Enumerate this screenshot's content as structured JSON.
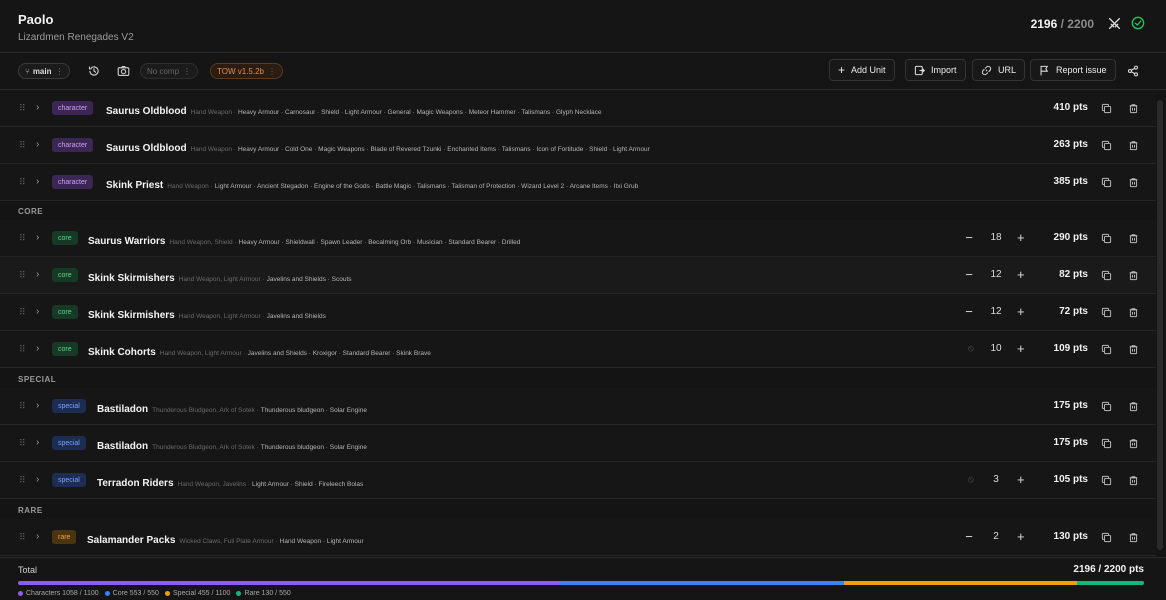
{
  "header": {
    "title": "Paolo",
    "subtitle": "Lizardmen Renegades V2",
    "points_current": "2196",
    "points_max": "2200"
  },
  "toolbar": {
    "branch": "main",
    "comp": "No comp",
    "version": "TOW v1.5.2b",
    "add_unit": "Add Unit",
    "import": "Import",
    "url": "URL",
    "report": "Report issue"
  },
  "sections": {
    "core": "CORE",
    "special": "SPECIAL",
    "rare": "RARE"
  },
  "units": [
    {
      "category": "character",
      "name": "Saurus Oldblood",
      "defaults": "Hand Weapon ·",
      "options": "Heavy Armour · Carnosaur · Shield · Light Armour · General · Magic Weapons · Meteor Hammer · Talismans · Glyph Necklace",
      "qty": "",
      "points": "410 pts"
    },
    {
      "category": "character",
      "name": "Saurus Oldblood",
      "defaults": "Hand Weapon ·",
      "options": "Heavy Armour · Cold One · Magic Weapons · Blade of Revered Tzunki · Enchanted Items · Talismans · Icon of Fortitude · Shield · Light Armour",
      "qty": "",
      "points": "263 pts"
    },
    {
      "category": "character",
      "name": "Skink Priest",
      "defaults": "Hand Weapon ·",
      "options": "Light Armour · Ancient Stegadon · Engine of the Gods · Battle Magic · Talismans · Talisman of Protection · Wizard Level 2 · Arcane Items · Itxi Grub",
      "qty": "",
      "points": "385 pts"
    },
    {
      "category": "core",
      "name": "Saurus Warriors",
      "defaults": "Hand Weapon, Shield ·",
      "options": "Heavy Armour · Shieldwall · Spawn Leader · Becalming Orb · Musician · Standard Bearer · Drilled",
      "qty": "18",
      "points": "290 pts"
    },
    {
      "category": "core",
      "name": "Skink Skirmishers",
      "defaults": "Hand Weapon, Light Armour ·",
      "options": "Javelins and Shields · Scouts",
      "qty": "12",
      "points": "82 pts"
    },
    {
      "category": "core",
      "name": "Skink Skirmishers",
      "defaults": "Hand Weapon, Light Armour ·",
      "options": "Javelins and Shields",
      "qty": "12",
      "points": "72 pts"
    },
    {
      "category": "core",
      "name": "Skink Cohorts",
      "defaults": "Hand Weapon, Light Armour ·",
      "options": "Javelins and Shields · Kroxigor · Standard Bearer · Skink Brave",
      "qty": "10",
      "points": "109 pts"
    },
    {
      "category": "special",
      "name": "Bastiladon",
      "defaults": "Thunderous Bludgeon, Ark of Sotek ·",
      "options": "Thunderous bludgeon · Solar Engine",
      "qty": "",
      "points": "175 pts"
    },
    {
      "category": "special",
      "name": "Bastiladon",
      "defaults": "Thunderous Bludgeon, Ark of Sotek ·",
      "options": "Thunderous bludgeon · Solar Engine",
      "qty": "",
      "points": "175 pts"
    },
    {
      "category": "special",
      "name": "Terradon Riders",
      "defaults": "Hand Weapon, Javelins ·",
      "options": "Light Armour · Shield · Fireleech Bolas",
      "qty": "3",
      "points": "105 pts"
    },
    {
      "category": "rare",
      "name": "Salamander Packs",
      "defaults": "Wicked Claws, Full Plate Armour ·",
      "options": "Hand Weapon · Light Armour",
      "qty": "2",
      "points": "130 pts"
    }
  ],
  "footer": {
    "total_label": "Total",
    "total_value": "2196 / 2200 pts",
    "legend": [
      {
        "label": "Characters 1058 / 1100",
        "value": 1058,
        "color": "#8b5cf6"
      },
      {
        "label": "Core 553 / 550",
        "value": 553,
        "color": "#3b82f6"
      },
      {
        "label": "Special 455 / 1100",
        "value": 455,
        "color": "#f59e0b"
      },
      {
        "label": "Rare 130 / 550",
        "value": 130,
        "color": "#10b981"
      }
    ]
  },
  "colors": {
    "background": "#141414",
    "tow_accent": "#f08a3c",
    "valid_check": "#22c55e"
  }
}
